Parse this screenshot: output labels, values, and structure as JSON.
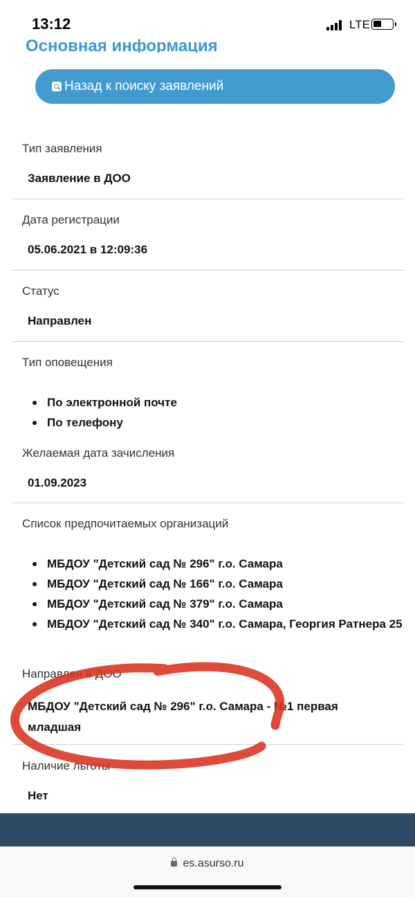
{
  "status_bar": {
    "time": "13:12",
    "network": "LTE"
  },
  "header": {
    "section_title": "Основная информация",
    "back_button": "Назад к поиску заявлений"
  },
  "fields": {
    "type": {
      "label": "Тип заявления",
      "value": "Заявление в ДОО"
    },
    "reg_date": {
      "label": "Дата регистрации",
      "value": "05.06.2021 в 12:09:36"
    },
    "status": {
      "label": "Статус",
      "value": "Направлен"
    },
    "notify": {
      "label": "Тип оповещения",
      "items": [
        "По электронной почте",
        "По телефону"
      ]
    },
    "desired_date": {
      "label": "Желаемая дата зачисления",
      "value": "01.09.2023"
    },
    "orgs": {
      "label": "Список предпочитаемых организаций",
      "items": [
        "МБДОУ \"Детский сад № 296\" г.о. Самара",
        "МБДОУ \"Детский сад № 166\" г.о. Самара",
        "МБДОУ \"Детский сад № 379\" г.о. Самара",
        "МБДОУ \"Детский сад № 340\" г.о. Самара, Георгия Ратнера 25"
      ]
    },
    "assigned": {
      "label": "Направлен в ДОО",
      "value": "МБДОУ \"Детский сад № 296\" г.о. Самара - №1 первая младшая"
    },
    "benefit": {
      "label": "Наличие льготы",
      "value": "Нет"
    }
  },
  "browser": {
    "url": "es.asurso.ru"
  },
  "colors": {
    "accent": "#429bcf",
    "title": "#3f98cc",
    "footer": "#2c4a63",
    "highlight_stroke": "#d9321f"
  }
}
